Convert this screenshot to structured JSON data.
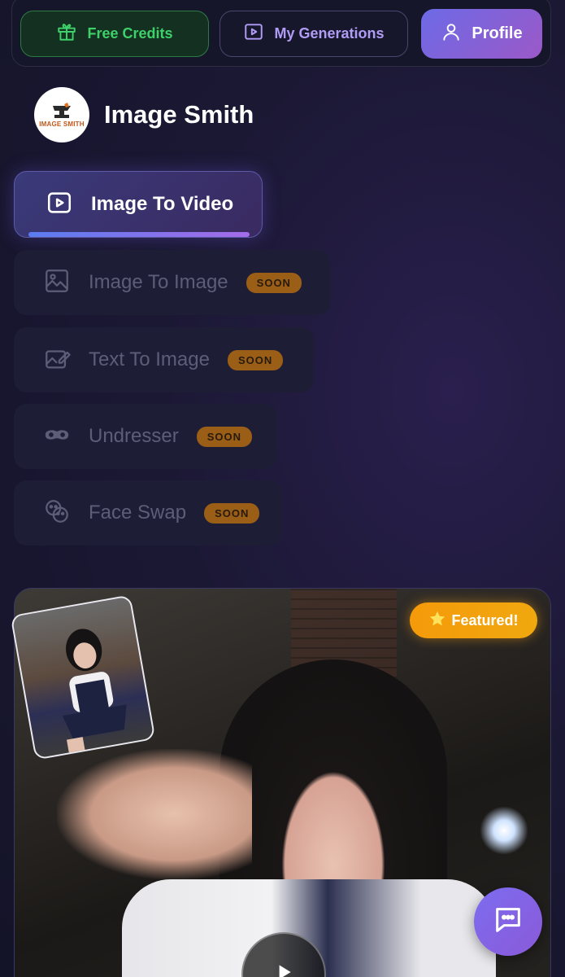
{
  "topbar": {
    "free_credits": "Free Credits",
    "my_generations": "My Generations",
    "profile": "Profile"
  },
  "brand": {
    "logo_text": "IMAGE SMITH",
    "title": "Image Smith"
  },
  "nav": {
    "image_to_video": "Image To Video",
    "image_to_image": "Image To Image",
    "text_to_image": "Text To Image",
    "undresser": "Undresser",
    "face_swap": "Face Swap",
    "soon_badge": "SOON"
  },
  "card": {
    "featured_label": "Featured!"
  },
  "colors": {
    "accent": "#6d6ae6",
    "credits_green": "#3fd06a",
    "soon_orange": "#b06a12",
    "featured_orange": "#f59a0a"
  },
  "icons": {
    "credits": "gift-icon",
    "generations": "play-box-icon",
    "profile": "user-icon",
    "image_to_video": "play-box-icon",
    "image_to_image": "image-icon",
    "text_to_image": "image-edit-icon",
    "undresser": "mask-icon",
    "face_swap": "faces-icon",
    "featured": "star-icon",
    "chat": "chat-icon",
    "play": "play-icon"
  }
}
